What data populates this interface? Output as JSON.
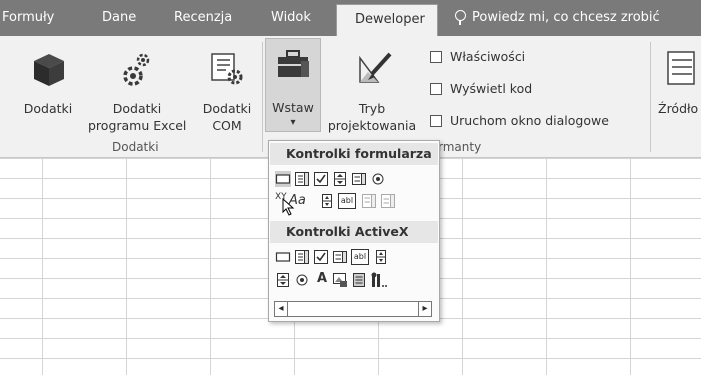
{
  "tabs": [
    {
      "label": "Formuły"
    },
    {
      "label": "Dane"
    },
    {
      "label": "Recenzja"
    },
    {
      "label": "Widok"
    },
    {
      "label": "Deweloper"
    },
    {
      "label": "Powiedz mi, co chcesz zrobić"
    }
  ],
  "ribbon": {
    "dodatki_group": {
      "dodatki": "Dodatki",
      "excel_line1": "Dodatki",
      "excel_line2": "programu Excel",
      "com_line1": "Dodatki",
      "com_line2": "COM",
      "group_label": "Dodatki"
    },
    "controls_group": {
      "wstaw": "Wstaw",
      "wstaw_arrow": "▾",
      "tryb_line1": "Tryb",
      "tryb_line2": "projektowania",
      "wlasciwosci": "Właściwości",
      "wyswietl_kod": "Wyświetl kod",
      "uruchom": "Uruchom okno dialogowe",
      "group_label_tail": "rmanty"
    },
    "xml_group": {
      "zrodlo": "Źródło"
    }
  },
  "dropdown": {
    "form_header": "Kontrolki formularza",
    "activex_header": "Kontrolki ActiveX",
    "form_controls": [
      "button",
      "combo-box",
      "checkbox",
      "spin-button",
      "list-box",
      "option-button",
      "label",
      "text-aa",
      "scrollbar",
      "text-field",
      "combo-list-edit",
      "combo-dropdown-edit"
    ],
    "activex_controls": [
      "command-button",
      "combo-box",
      "checkbox",
      "list-box",
      "text-box",
      "scrollbar",
      "spin-button",
      "option-button",
      "label",
      "image",
      "toggle-button",
      "more-controls"
    ],
    "label_text": "XY",
    "text_aa": "Aa",
    "textfield_text": "abl",
    "activex_label": "A",
    "scroll_left": "◂",
    "scroll_right": "▸"
  },
  "colors": {
    "tabbar": "#7a7a7a",
    "ribbon": "#f1f1f1",
    "dropdown_header": "#e6e6e6"
  }
}
